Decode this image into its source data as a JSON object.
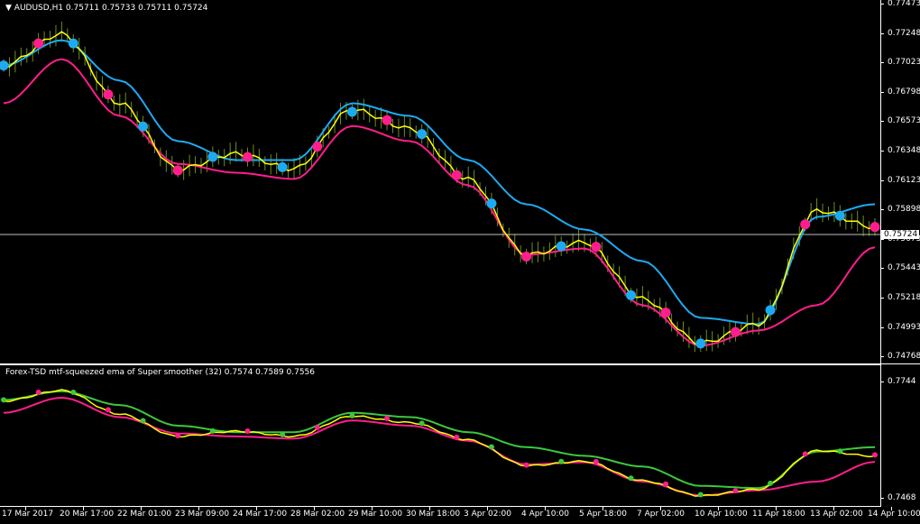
{
  "header": {
    "symbol_arrow": "▼",
    "symbol_info": "AUDUSD,H1  0.75711 0.75733 0.75711 0.75724"
  },
  "indicator": {
    "title": "Forex-TSD mtf-squeezed ema of Super smoother (32) 0.7574 0.7589 0.7556"
  },
  "current_price": "0.75724",
  "price_axis": [
    "0.77473",
    "0.77248",
    "0.77023",
    "0.76798",
    "0.76573",
    "0.76348",
    "0.76123",
    "0.75898",
    "0.75673",
    "0.75443",
    "0.75218",
    "0.74993",
    "0.74768"
  ],
  "sub_axis": [
    "0.7744",
    "0.7468"
  ],
  "time_axis": [
    "17 Mar 2017",
    "20 Mar 17:00",
    "22 Mar 01:00",
    "23 Mar 09:00",
    "24 Mar 17:00",
    "28 Mar 02:00",
    "29 Mar 10:00",
    "30 Mar 18:00",
    "3 Apr 02:00",
    "4 Apr 10:00",
    "5 Apr 18:00",
    "7 Apr 02:00",
    "10 Apr 10:00",
    "11 Apr 18:00",
    "13 Apr 02:00",
    "14 Apr 10:00"
  ],
  "colors": {
    "background": "#000000",
    "bars": "#6b8e23",
    "ema_blue": "#1eaaf0",
    "ema_pink": "#ff1e8c",
    "fast_yellow": "#ffff00",
    "signal_green": "#3cc83c",
    "grid_line": "#c0c0c0"
  },
  "chart_data": {
    "type": "line",
    "title": "AUDUSD,H1",
    "ylim": [
      0.7466,
      0.7749
    ],
    "x": [
      "17 Mar 2017",
      "20 Mar 17:00",
      "22 Mar 01:00",
      "23 Mar 09:00",
      "24 Mar 17:00",
      "28 Mar 02:00",
      "29 Mar 10:00",
      "30 Mar 18:00",
      "3 Apr 02:00",
      "4 Apr 10:00",
      "5 Apr 18:00",
      "7 Apr 02:00",
      "10 Apr 10:00",
      "11 Apr 18:00",
      "13 Apr 02:00",
      "14 Apr 10:00"
    ],
    "series": [
      {
        "values": [
          0.77,
          0.7725,
          0.767,
          0.7618,
          0.763,
          0.7618,
          0.7665,
          0.765,
          0.761,
          0.755,
          0.756,
          0.7515,
          0.748,
          0.7495,
          0.7585,
          0.7572
        ]
      },
      {
        "values": [
          0.77,
          0.772,
          0.7688,
          0.764,
          0.7625,
          0.7625,
          0.767,
          0.766,
          0.7625,
          0.759,
          0.757,
          0.7545,
          0.75,
          0.7495,
          0.758,
          0.759
        ]
      },
      {
        "values": [
          0.767,
          0.7705,
          0.766,
          0.7622,
          0.7615,
          0.761,
          0.7652,
          0.764,
          0.7605,
          0.755,
          0.7555,
          0.751,
          0.7478,
          0.749,
          0.751,
          0.7556
        ]
      }
    ]
  }
}
